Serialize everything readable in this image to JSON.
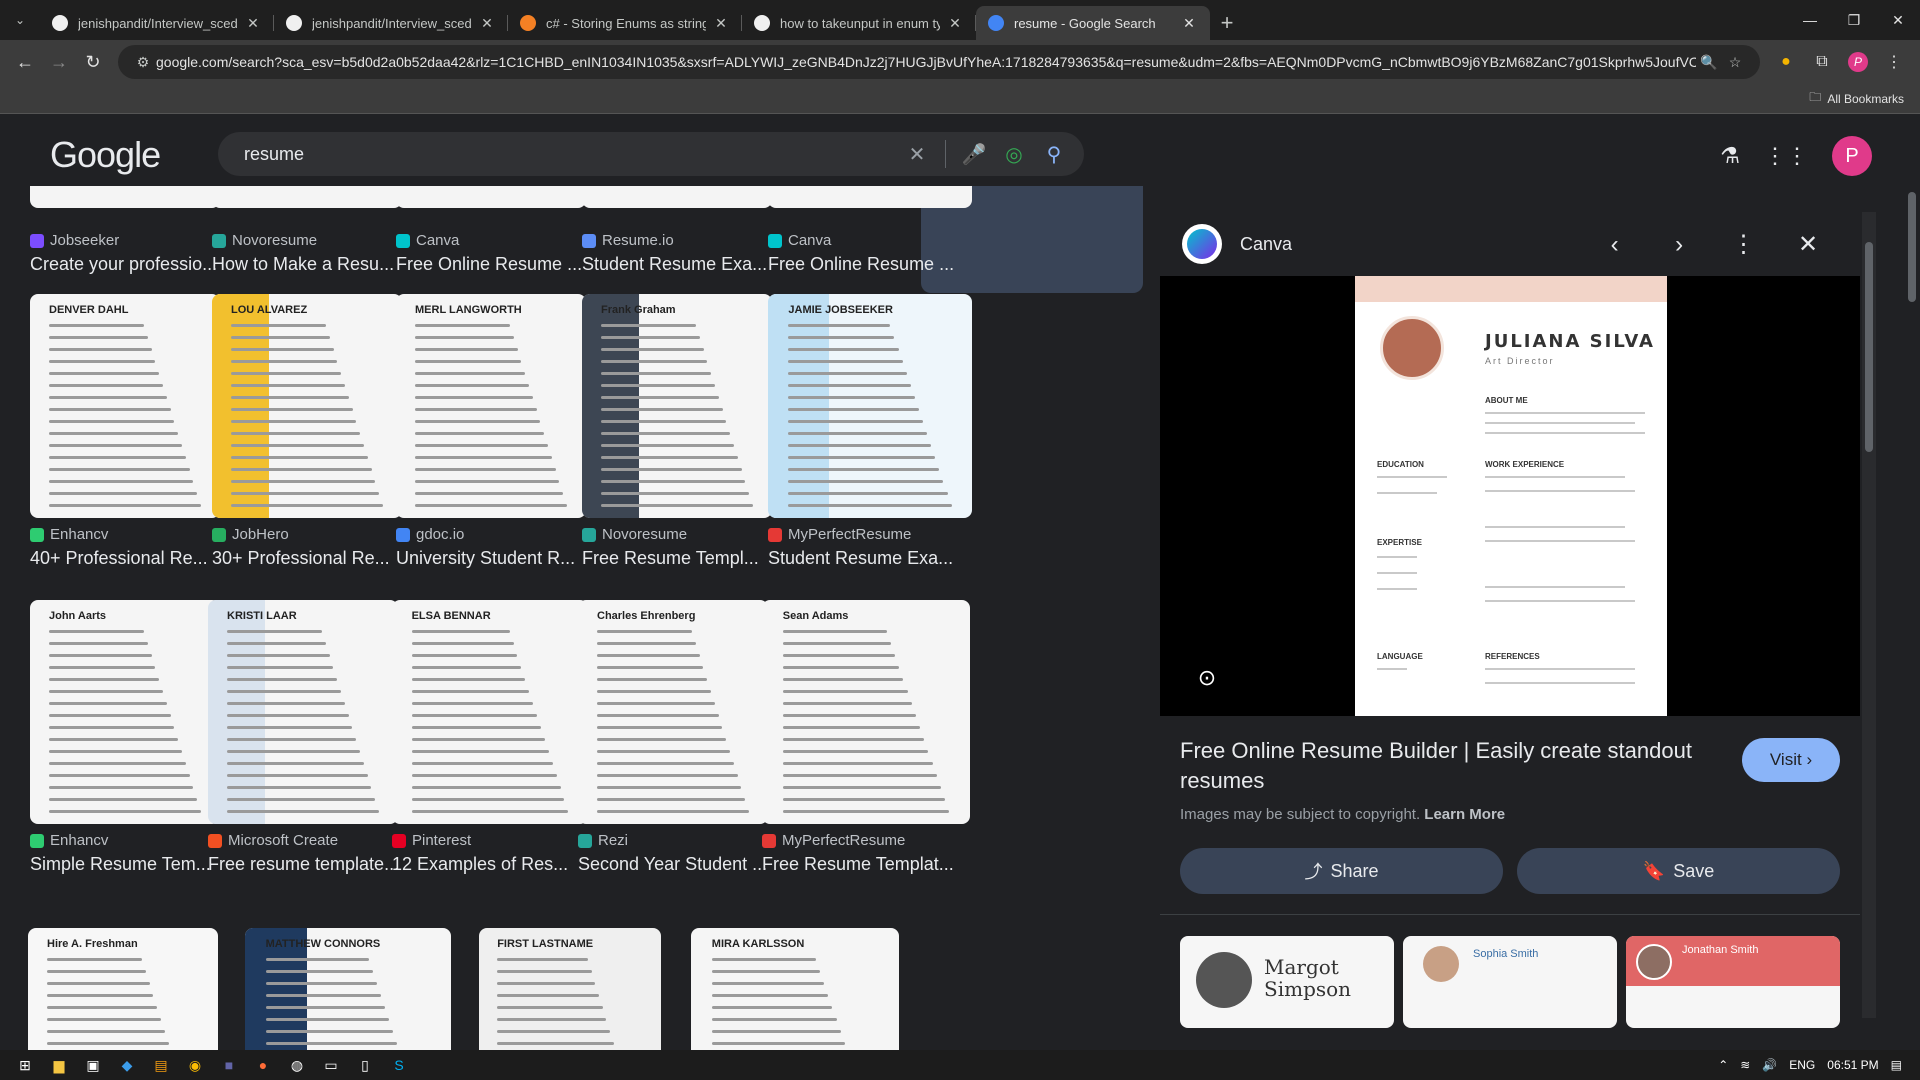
{
  "browser": {
    "tabs": [
      {
        "title": "jenishpandit/Interview_scedular",
        "color": "#f0f0f0",
        "active": false
      },
      {
        "title": "jenishpandit/Interview_scedular",
        "color": "#f0f0f0",
        "active": false
      },
      {
        "title": "c# - Storing Enums as strings in",
        "color": "#f48024",
        "active": false
      },
      {
        "title": "how to takeunput in enum type",
        "color": "#f0f0f0",
        "active": false
      },
      {
        "title": "resume - Google Search",
        "color": "#4285f4",
        "active": true
      }
    ],
    "url": "google.com/search?sca_esv=b5d0d2a0b52daa42&rlz=1C1CHBD_enIN1034IN1035&sxsrf=ADLYWIJ_zeGNB4DnJz2j7HUGJjBvUfYheA:1718284793635&q=resume&udm=2&fbs=AEQNm0DPvcmG_nCbmwtBO9j6YBzM68ZanC7g01Skprhw5JoufVCi...",
    "bookmarks_label": "All Bookmarks",
    "profile_initial": "P"
  },
  "google": {
    "logo": "Google",
    "query": "resume",
    "profile_initial": "P"
  },
  "results": [
    {
      "source": "Jobseeker",
      "title": "Create your professio...",
      "color": "#7c4dff"
    },
    {
      "source": "Novoresume",
      "title": "How to Make a Resu...",
      "color": "#26a69a"
    },
    {
      "source": "Canva",
      "title": "Free Online Resume ...",
      "color": "#00c4cc"
    },
    {
      "source": "Resume.io",
      "title": "Student Resume Exa...",
      "color": "#5c8df6"
    },
    {
      "source": "Canva",
      "title": "Free Online Resume ...",
      "color": "#00c4cc"
    },
    {
      "source": "Enhancv",
      "title": "40+ Professional Re...",
      "color": "#2ecc71"
    },
    {
      "source": "JobHero",
      "title": "30+ Professional Re...",
      "color": "#27ae60"
    },
    {
      "source": "gdoc.io",
      "title": "University Student R...",
      "color": "#4285f4"
    },
    {
      "source": "Novoresume",
      "title": "Free Resume Templ...",
      "color": "#26a69a"
    },
    {
      "source": "MyPerfectResume",
      "title": "Student Resume Exa...",
      "color": "#e53935"
    },
    {
      "source": "Enhancv",
      "title": "Simple Resume Tem...",
      "color": "#2ecc71"
    },
    {
      "source": "Microsoft Create",
      "title": "Free resume template...",
      "color": "#f25022"
    },
    {
      "source": "Pinterest",
      "title": "12 Examples of Res...",
      "color": "#e60023"
    },
    {
      "source": "Rezi",
      "title": "Second Year Student ...",
      "color": "#26a69a"
    },
    {
      "source": "MyPerfectResume",
      "title": "Free Resume Templat...",
      "color": "#e53935"
    }
  ],
  "thumb_headers": [
    "DENVER DAHL",
    "LOU ALVAREZ",
    "MERL LANGWORTH",
    "Frank Graham",
    "JAMIE JOBSEEKER",
    "John Aarts",
    "KRISTI LAAR",
    "ELSA BENNAR",
    "Charles Ehrenberg",
    "Sean Adams",
    "Hire A. Freshman",
    "MATTHEW CONNORS",
    "FIRST LASTNAME",
    "MIRA KARLSSON"
  ],
  "panel": {
    "source": "Canva",
    "title": "Free Online Resume Builder | Easily create standout resumes",
    "visit_label": "Visit",
    "copyright_text": "Images may be subject to copyright.",
    "learn_more": "Learn More",
    "share_label": "Share",
    "save_label": "Save",
    "preview": {
      "name": "JULIANA SILVA",
      "role": "Art Director",
      "sections": [
        "ABOUT ME",
        "EDUCATION",
        "WORK EXPERIENCE",
        "EXPERTISE",
        "LANGUAGE",
        "REFERENCES"
      ]
    },
    "related": [
      "Margot Simpson",
      "Sophia Smith",
      "Jonathan Smith"
    ]
  },
  "taskbar": {
    "lang": "ENG",
    "time": "06:51 PM"
  }
}
